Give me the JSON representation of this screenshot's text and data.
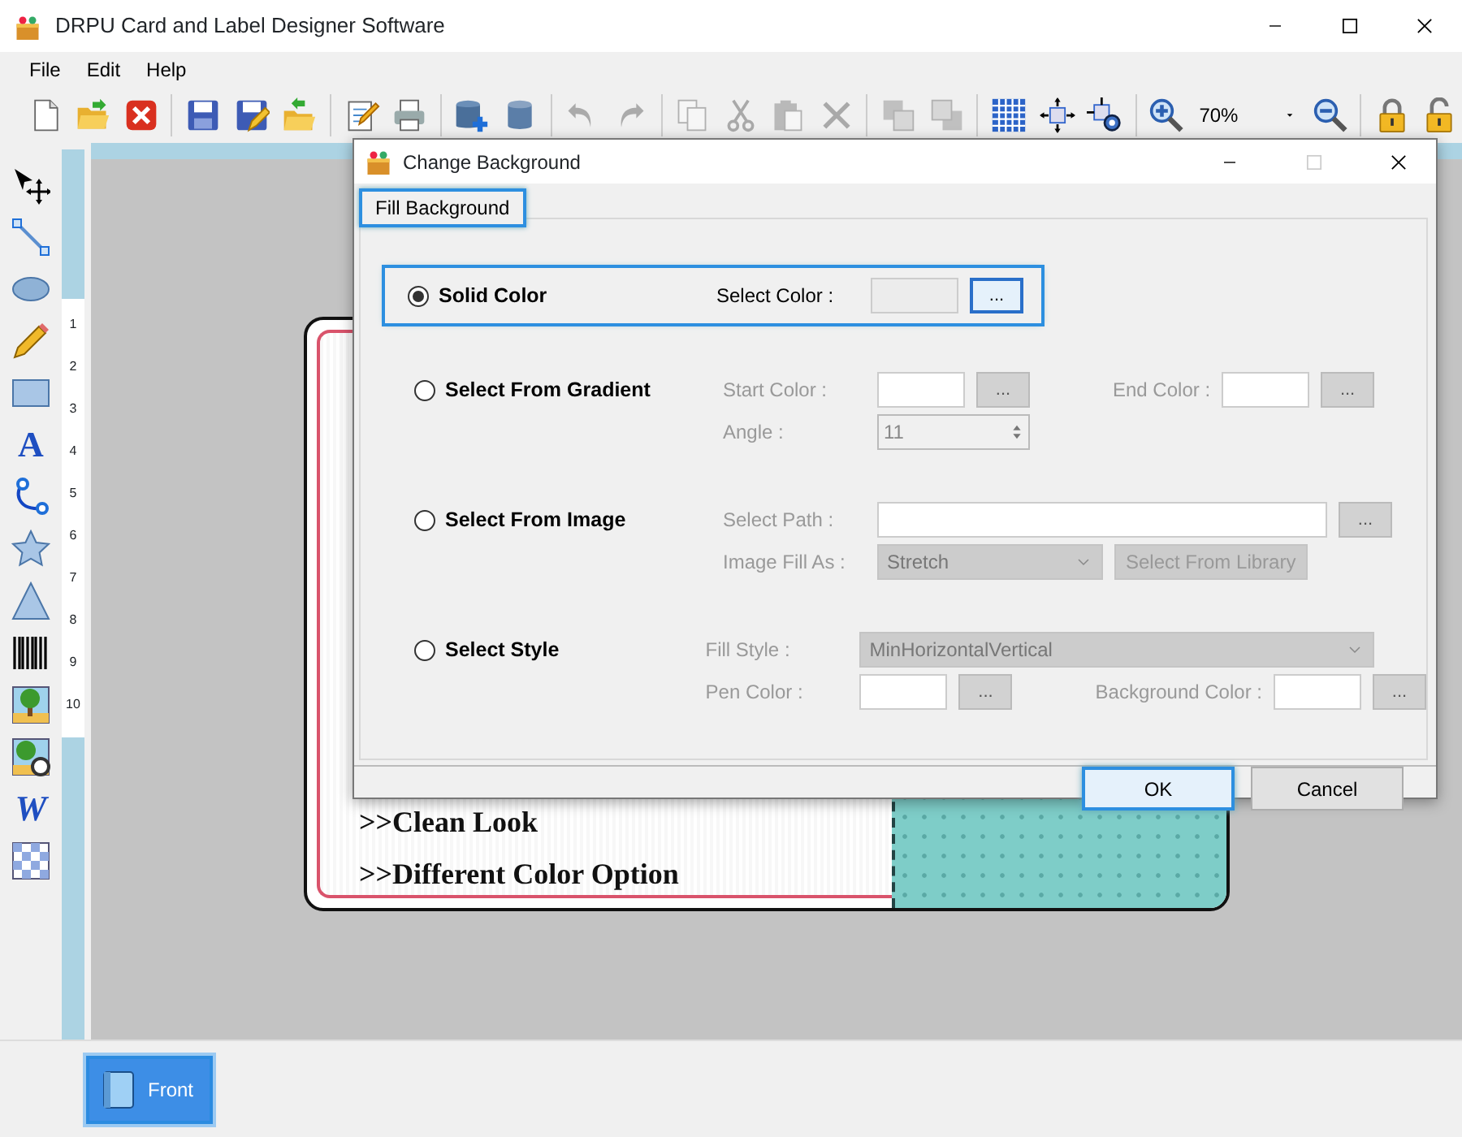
{
  "window": {
    "title": "DRPU Card and Label Designer Software"
  },
  "menu": [
    "File",
    "Edit",
    "Help"
  ],
  "toolbar": [
    {
      "kind": "new",
      "disabled": false
    },
    {
      "kind": "open",
      "disabled": false
    },
    {
      "kind": "close",
      "disabled": false
    },
    {
      "kind": "sep"
    },
    {
      "kind": "save",
      "disabled": false
    },
    {
      "kind": "saveas",
      "disabled": false
    },
    {
      "kind": "export",
      "disabled": false
    },
    {
      "kind": "sep"
    },
    {
      "kind": "edit",
      "disabled": false
    },
    {
      "kind": "print",
      "disabled": false
    },
    {
      "kind": "sep"
    },
    {
      "kind": "dbadd",
      "disabled": false
    },
    {
      "kind": "db",
      "disabled": false
    },
    {
      "kind": "sep"
    },
    {
      "kind": "undo",
      "disabled": true
    },
    {
      "kind": "redo",
      "disabled": true
    },
    {
      "kind": "sep"
    },
    {
      "kind": "copy",
      "disabled": true
    },
    {
      "kind": "cut",
      "disabled": true
    },
    {
      "kind": "paste",
      "disabled": true
    },
    {
      "kind": "delete",
      "disabled": true
    },
    {
      "kind": "sep"
    },
    {
      "kind": "front",
      "disabled": true
    },
    {
      "kind": "back",
      "disabled": true
    },
    {
      "kind": "sep"
    },
    {
      "kind": "grid",
      "disabled": false
    },
    {
      "kind": "fit",
      "disabled": false
    },
    {
      "kind": "fitgear",
      "disabled": false
    },
    {
      "kind": "sep"
    },
    {
      "kind": "zoomin",
      "disabled": false
    },
    {
      "kind": "zoom",
      "value": "70%"
    },
    {
      "kind": "zoomout",
      "disabled": false
    },
    {
      "kind": "sep"
    },
    {
      "kind": "lock",
      "disabled": false
    },
    {
      "kind": "unlock",
      "disabled": false
    }
  ],
  "tools": [
    {
      "kind": "pointer"
    },
    {
      "kind": "line"
    },
    {
      "kind": "ellipse"
    },
    {
      "kind": "pencil"
    },
    {
      "kind": "rect"
    },
    {
      "kind": "text",
      "label": "A"
    },
    {
      "kind": "curve"
    },
    {
      "kind": "star"
    },
    {
      "kind": "triangle"
    },
    {
      "kind": "barcode"
    },
    {
      "kind": "image"
    },
    {
      "kind": "imageclip"
    },
    {
      "kind": "wordart",
      "label": "W"
    },
    {
      "kind": "pattern"
    }
  ],
  "ruler": [
    "1",
    "2",
    "3",
    "4",
    "5",
    "6",
    "7",
    "8",
    "9",
    "10"
  ],
  "card": {
    "lines": [
      ">>Clean Look",
      ">>Different Color Option"
    ]
  },
  "pages": [
    {
      "label": "Front",
      "selected": true
    }
  ],
  "dialog": {
    "title": "Change Background",
    "tab": {
      "label": "Fill Background",
      "selected": true
    },
    "options": [
      {
        "label": "Solid Color",
        "selected": true,
        "rows": [
          [
            {
              "kind": "label",
              "text": "Select Color :"
            },
            {
              "kind": "color"
            },
            {
              "kind": "browse",
              "text": "..."
            }
          ]
        ]
      },
      {
        "label": "Select From Gradient",
        "selected": false,
        "rows": [
          [
            {
              "kind": "label",
              "text": "Start Color :"
            },
            {
              "kind": "color"
            },
            {
              "kind": "browse",
              "text": "..."
            },
            {
              "kind": "label",
              "text": "End Color :"
            },
            {
              "kind": "color"
            },
            {
              "kind": "browse",
              "text": "..."
            }
          ],
          [
            {
              "kind": "label",
              "text": "Angle :"
            },
            {
              "kind": "spin",
              "value": "11"
            }
          ]
        ]
      },
      {
        "label": "Select From Image",
        "selected": false,
        "rows": [
          [
            {
              "kind": "label",
              "text": "Select Path :"
            },
            {
              "kind": "path"
            },
            {
              "kind": "browse",
              "text": "..."
            }
          ],
          [
            {
              "kind": "label",
              "text": "Image Fill As :"
            },
            {
              "kind": "select",
              "value": "Stretch"
            },
            {
              "kind": "button",
              "text": "Select From Library"
            }
          ]
        ]
      },
      {
        "label": "Select Style",
        "selected": false,
        "rows": [
          [
            {
              "kind": "label",
              "text": "Fill Style :"
            },
            {
              "kind": "select",
              "value": "MinHorizontalVertical"
            }
          ],
          [
            {
              "kind": "label",
              "text": "Pen Color :"
            },
            {
              "kind": "color"
            },
            {
              "kind": "browse",
              "text": "..."
            },
            {
              "kind": "label",
              "text": "Background Color :"
            },
            {
              "kind": "color"
            },
            {
              "kind": "browse",
              "text": "..."
            }
          ]
        ]
      }
    ],
    "buttons": [
      {
        "label": "OK",
        "highlighted": true
      },
      {
        "label": "Cancel",
        "highlighted": false
      }
    ]
  }
}
